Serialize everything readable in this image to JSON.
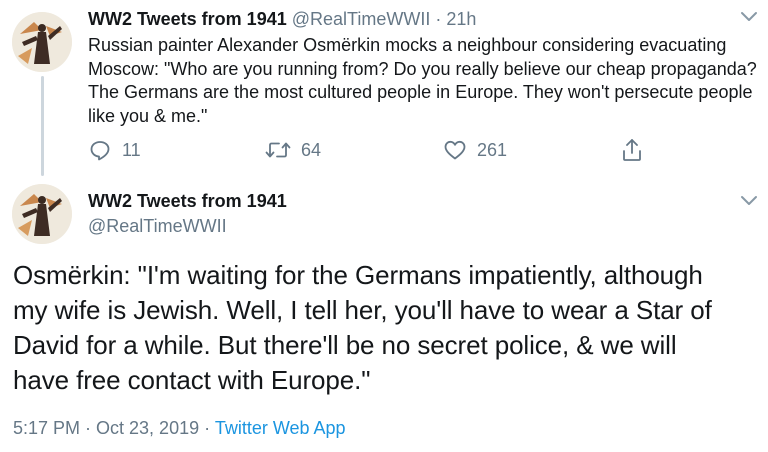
{
  "tweet1": {
    "display_name": "WW2 Tweets from 1941",
    "handle": "@RealTimeWWII",
    "separator": "·",
    "time_ago": "21h",
    "avatar_icon": "soldier-avatar-icon",
    "text_lines": [
      "Russian painter Alexander Osmërkin mocks a neighbour considering evacuating",
      "Moscow: \"Who are you running from? Do you really believe our cheap propaganda?",
      "The Germans are the most cultured people in Europe. They won't persecute people",
      "like you & me.\""
    ],
    "actions": {
      "reply_count": "11",
      "retweet_count": "64",
      "like_count": "261"
    }
  },
  "tweet2": {
    "display_name": "WW2 Tweets from 1941",
    "handle": "@RealTimeWWII",
    "avatar_icon": "soldier-avatar-icon",
    "text_lines": [
      "Osmërkin: \"I'm waiting for the Germans impatiently, although",
      "my wife is Jewish. Well, I tell her, you'll have to wear a Star of",
      "David for a while. But there'll be no secret police, & we will",
      "have free contact with Europe.\""
    ],
    "timestamp": "5:17 PM · Oct 23, 2019",
    "separator": "·",
    "source": "Twitter Web App"
  },
  "colors": {
    "text": "#14171a",
    "secondary": "#657786",
    "link": "#1b95e0",
    "thread_line": "#cdd6dd"
  }
}
